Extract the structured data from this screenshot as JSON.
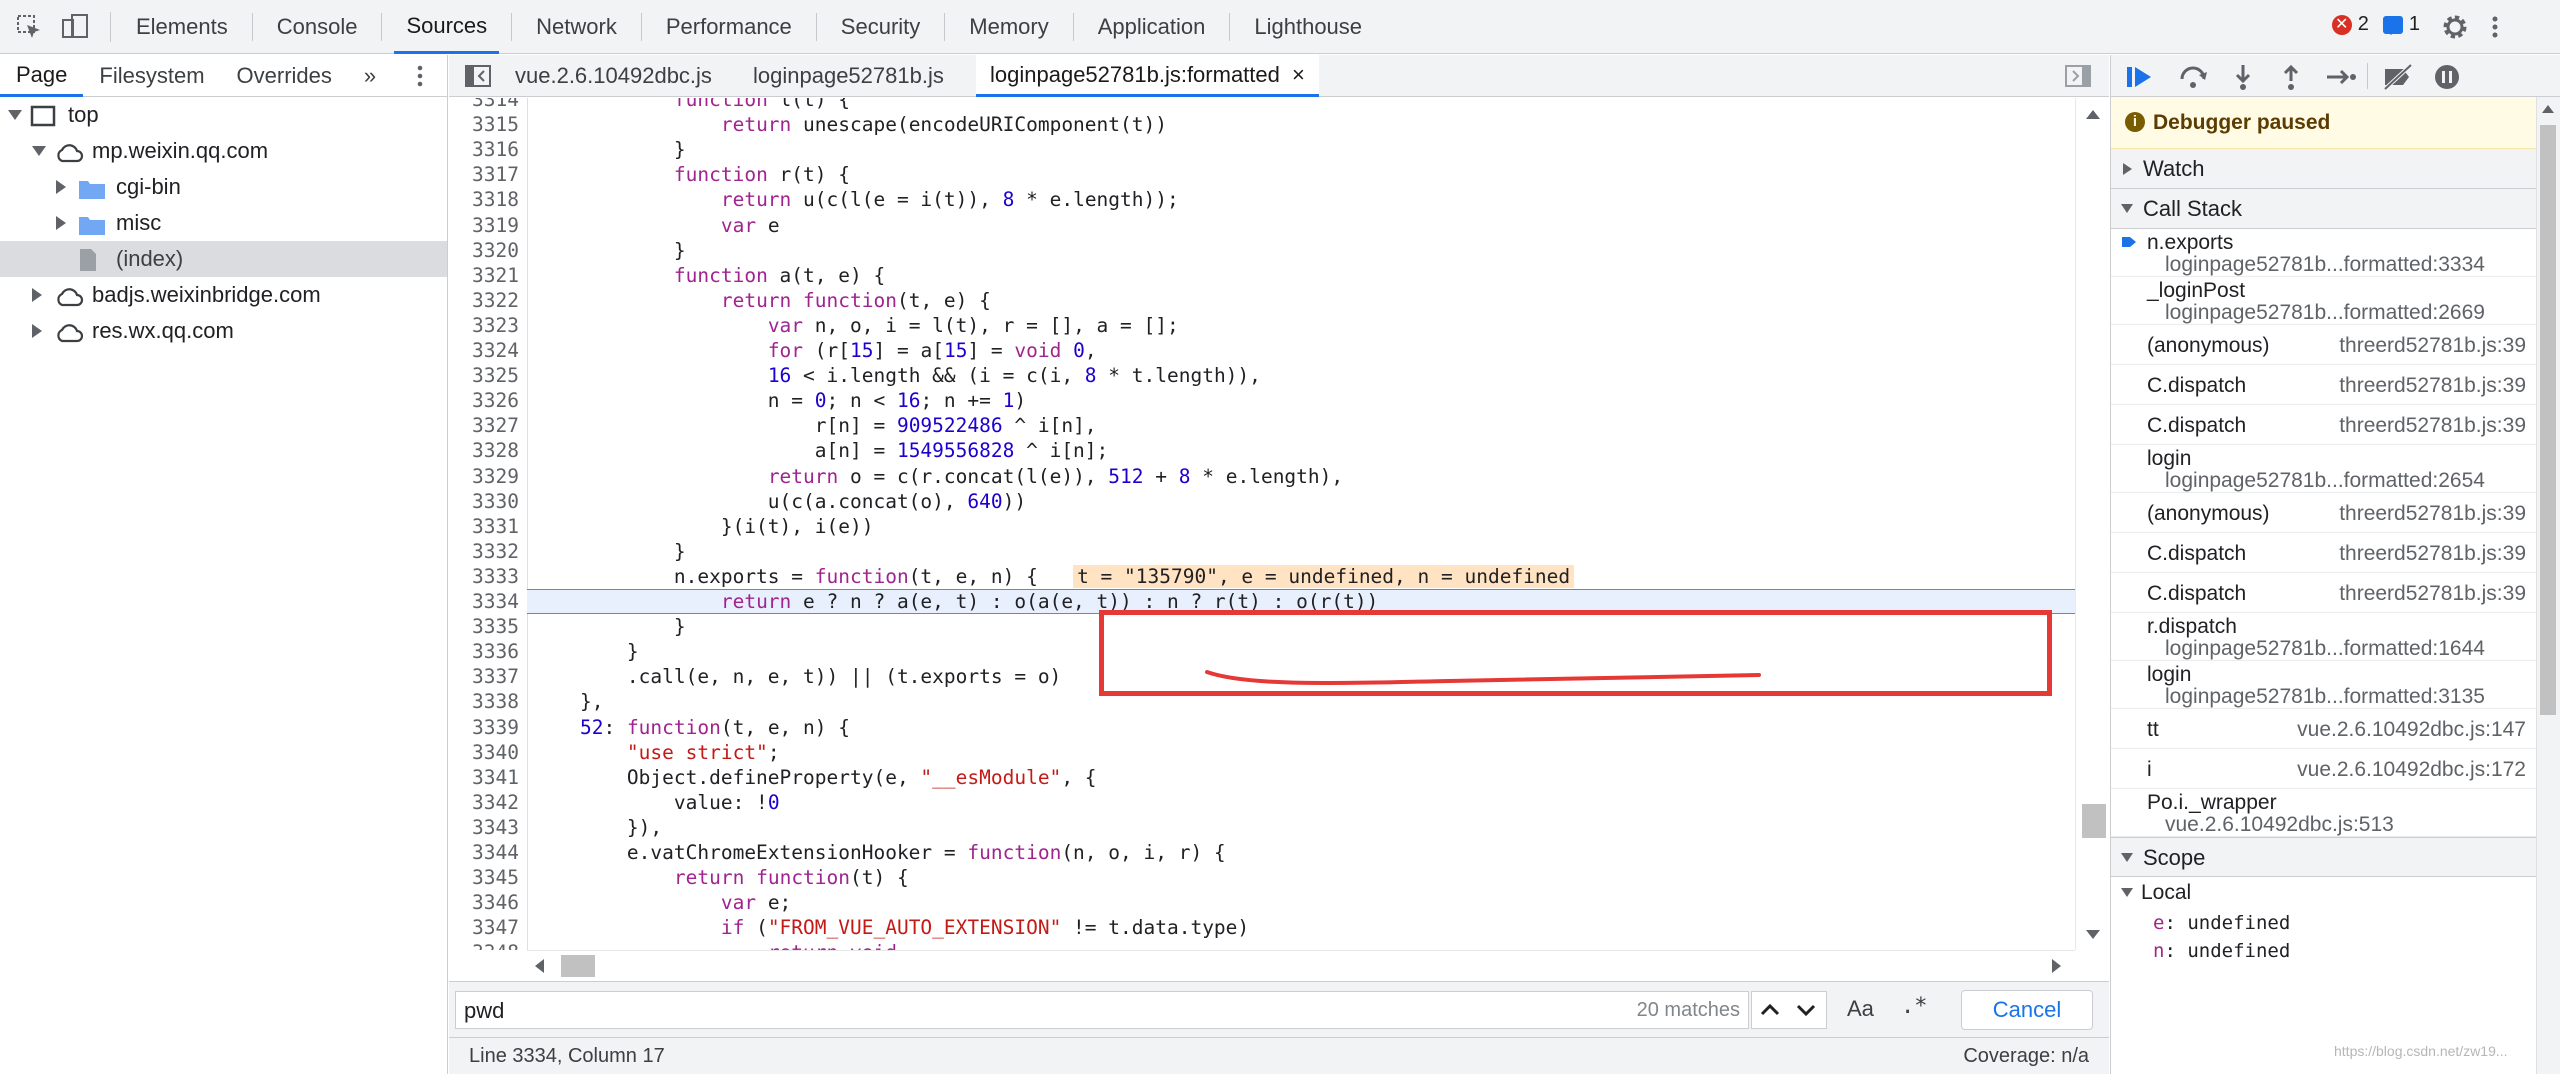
{
  "toolbar": {
    "tabs": [
      "Elements",
      "Console",
      "Sources",
      "Network",
      "Performance",
      "Security",
      "Memory",
      "Application",
      "Lighthouse"
    ],
    "active_tab": "Sources",
    "error_count": "2",
    "message_count": "1"
  },
  "navigator": {
    "tabs": [
      "Page",
      "Filesystem",
      "Overrides"
    ],
    "more": "»",
    "tree": [
      {
        "label": "top",
        "level": 0,
        "icon": "frame-icon",
        "open": true
      },
      {
        "label": "mp.weixin.qq.com",
        "level": 1,
        "icon": "cloud-icon",
        "open": true
      },
      {
        "label": "cgi-bin",
        "level": 2,
        "icon": "folder-icon",
        "open": false
      },
      {
        "label": "misc",
        "level": 2,
        "icon": "folder-icon",
        "open": false
      },
      {
        "label": "(index)",
        "level": 2,
        "icon": "file-icon",
        "selected": true
      },
      {
        "label": "badjs.weixinbridge.com",
        "level": 1,
        "icon": "cloud-icon",
        "open": false
      },
      {
        "label": "res.wx.qq.com",
        "level": 1,
        "icon": "cloud-icon",
        "open": false
      }
    ]
  },
  "editor": {
    "tabs": [
      "vue.2.6.10492dbc.js",
      "loginpage52781b.js",
      "loginpage52781b.js:formatted"
    ],
    "active_tab": "loginpage52781b.js:formatted",
    "close_glyph": "×",
    "lines": [
      {
        "n": "3314",
        "t": "            function l(t) {"
      },
      {
        "n": "3315",
        "t": "                return unescape(encodeURIComponent(t))"
      },
      {
        "n": "3316",
        "t": "            }"
      },
      {
        "n": "3317",
        "t": "            function r(t) {"
      },
      {
        "n": "3318",
        "t": "                return u(c(l(e = i(t)), 8 * e.length));"
      },
      {
        "n": "3319",
        "t": "                var e"
      },
      {
        "n": "3320",
        "t": "            }"
      },
      {
        "n": "3321",
        "t": "            function a(t, e) {"
      },
      {
        "n": "3322",
        "t": "                return function(t, e) {"
      },
      {
        "n": "3323",
        "t": "                    var n, o, i = l(t), r = [], a = [];"
      },
      {
        "n": "3324",
        "t": "                    for (r[15] = a[15] = void 0,"
      },
      {
        "n": "3325",
        "t": "                    16 < i.length && (i = c(i, 8 * t.length)),"
      },
      {
        "n": "3326",
        "t": "                    n = 0; n < 16; n += 1)"
      },
      {
        "n": "3327",
        "t": "                        r[n] = 909522486 ^ i[n],"
      },
      {
        "n": "3328",
        "t": "                        a[n] = 1549556828 ^ i[n];"
      },
      {
        "n": "3329",
        "t": "                    return o = c(r.concat(l(e)), 512 + 8 * e.length),"
      },
      {
        "n": "3330",
        "t": "                    u(c(a.concat(o), 640))"
      },
      {
        "n": "3331",
        "t": "                }(i(t), i(e))"
      },
      {
        "n": "3332",
        "t": "            }"
      },
      {
        "n": "3333",
        "t": "            n.exports = function(t, e, n) {"
      },
      {
        "n": "3334",
        "t": "                return e ? n ? a(e, t) : o(a(e, t)) : n ? r(t) : o(r(t))"
      },
      {
        "n": "3335",
        "t": "            }"
      },
      {
        "n": "3336",
        "t": "        }"
      },
      {
        "n": "3337",
        "t": "        .call(e, n, e, t)) || (t.exports = o)"
      },
      {
        "n": "3338",
        "t": "    },"
      },
      {
        "n": "3339",
        "t": "    52: function(t, e, n) {"
      },
      {
        "n": "3340",
        "t": "        \"use strict\";"
      },
      {
        "n": "3341",
        "t": "        Object.defineProperty(e, \"__esModule\", {"
      },
      {
        "n": "3342",
        "t": "            value: !0"
      },
      {
        "n": "3343",
        "t": "        }),"
      },
      {
        "n": "3344",
        "t": "        e.vatChromeExtensionHooker = function(n, o, i, r) {"
      },
      {
        "n": "3345",
        "t": "            return function(t) {"
      },
      {
        "n": "3346",
        "t": "                var e;"
      },
      {
        "n": "3347",
        "t": "                if (\"FROM_VUE_AUTO_EXTENSION\" != t.data.type)"
      },
      {
        "n": "3348",
        "t": "                    return void"
      },
      {
        "n": "3349",
        "t": ""
      }
    ],
    "inline_values": "t = \"135790\", e = undefined, n = undefined",
    "paused_line": "3334"
  },
  "search": {
    "query": "pwd",
    "matches": "20 matches",
    "case_label": "Aa",
    "regex_label": ".*",
    "cancel_label": "Cancel"
  },
  "status": {
    "position": "Line 3334, Column 17",
    "coverage": "Coverage: n/a"
  },
  "debugger": {
    "paused_label": "Debugger paused",
    "watch_label": "Watch",
    "callstack_label": "Call Stack",
    "frames": [
      {
        "fn": "n.exports",
        "loc": "loginpage52781b...formatted:3334",
        "current": true,
        "two_line": true
      },
      {
        "fn": "_loginPost",
        "loc": "loginpage52781b...formatted:2669",
        "two_line": true
      },
      {
        "fn": "(anonymous)",
        "loc": "threerd52781b.js:39"
      },
      {
        "fn": "C.dispatch",
        "loc": "threerd52781b.js:39"
      },
      {
        "fn": "C.dispatch",
        "loc": "threerd52781b.js:39"
      },
      {
        "fn": "login",
        "loc": "loginpage52781b...formatted:2654",
        "two_line": true
      },
      {
        "fn": "(anonymous)",
        "loc": "threerd52781b.js:39"
      },
      {
        "fn": "C.dispatch",
        "loc": "threerd52781b.js:39"
      },
      {
        "fn": "C.dispatch",
        "loc": "threerd52781b.js:39"
      },
      {
        "fn": "r.dispatch",
        "loc": "loginpage52781b...formatted:1644",
        "two_line": true
      },
      {
        "fn": "login",
        "loc": "loginpage52781b...formatted:3135",
        "two_line": true
      },
      {
        "fn": "tt",
        "loc": "vue.2.6.10492dbc.js:147"
      },
      {
        "fn": "i",
        "loc": "vue.2.6.10492dbc.js:172"
      },
      {
        "fn": "Po.i._wrapper",
        "loc": "vue.2.6.10492dbc.js:513",
        "two_line": true
      }
    ],
    "scope_label": "Scope",
    "local_label": "Local",
    "scope_vars": [
      {
        "k": "e",
        "v": "undefined"
      },
      {
        "k": "n",
        "v": "undefined"
      }
    ]
  },
  "watermark": "https://blog.csdn.net/zw19..."
}
